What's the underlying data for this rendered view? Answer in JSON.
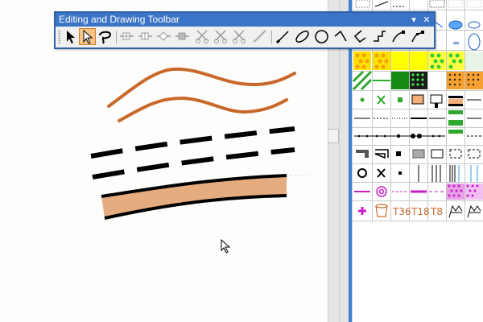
{
  "toolbar": {
    "title": "Editing and Drawing Toolbar",
    "menu_arrow": "▾",
    "close_label": "✕",
    "tools": [
      {
        "name": "select-arrow-icon",
        "active": false
      },
      {
        "name": "edit-arrow-icon",
        "active": true
      },
      {
        "name": "lasso-icon",
        "active": false
      },
      {
        "name": "node-add-icon",
        "active": false
      },
      {
        "name": "node-split-icon",
        "active": false
      },
      {
        "name": "node-diamond-icon",
        "active": false
      },
      {
        "name": "node-delete-icon",
        "active": false
      },
      {
        "name": "scissors-cut-icon",
        "active": false
      },
      {
        "name": "scissors-join-icon",
        "active": false
      },
      {
        "name": "scissors-alt-icon",
        "active": false
      },
      {
        "name": "smooth-line-icon",
        "active": false
      },
      {
        "name": "draw-line-icon",
        "active": false
      },
      {
        "name": "draw-ellipse-icon",
        "active": false
      },
      {
        "name": "draw-circle-icon",
        "active": false
      },
      {
        "name": "draw-angle-icon",
        "active": false
      },
      {
        "name": "draw-polygon-icon",
        "active": false
      },
      {
        "name": "draw-step-icon",
        "active": false
      },
      {
        "name": "draw-curve-icon",
        "active": false
      },
      {
        "name": "draw-dotted-curve-icon",
        "active": false
      }
    ]
  },
  "palette": {
    "text_labels": [
      "T36",
      "T18",
      "T8"
    ],
    "equals_label": "="
  },
  "colors": {
    "title_bar": "#3b74c6",
    "active_tool": "#f6c48a",
    "brown_line": "#c8692a",
    "road_fill": "#e5ac80",
    "green": "#2ea82e",
    "yellow": "#ffff00",
    "magenta": "#c81ec8"
  }
}
